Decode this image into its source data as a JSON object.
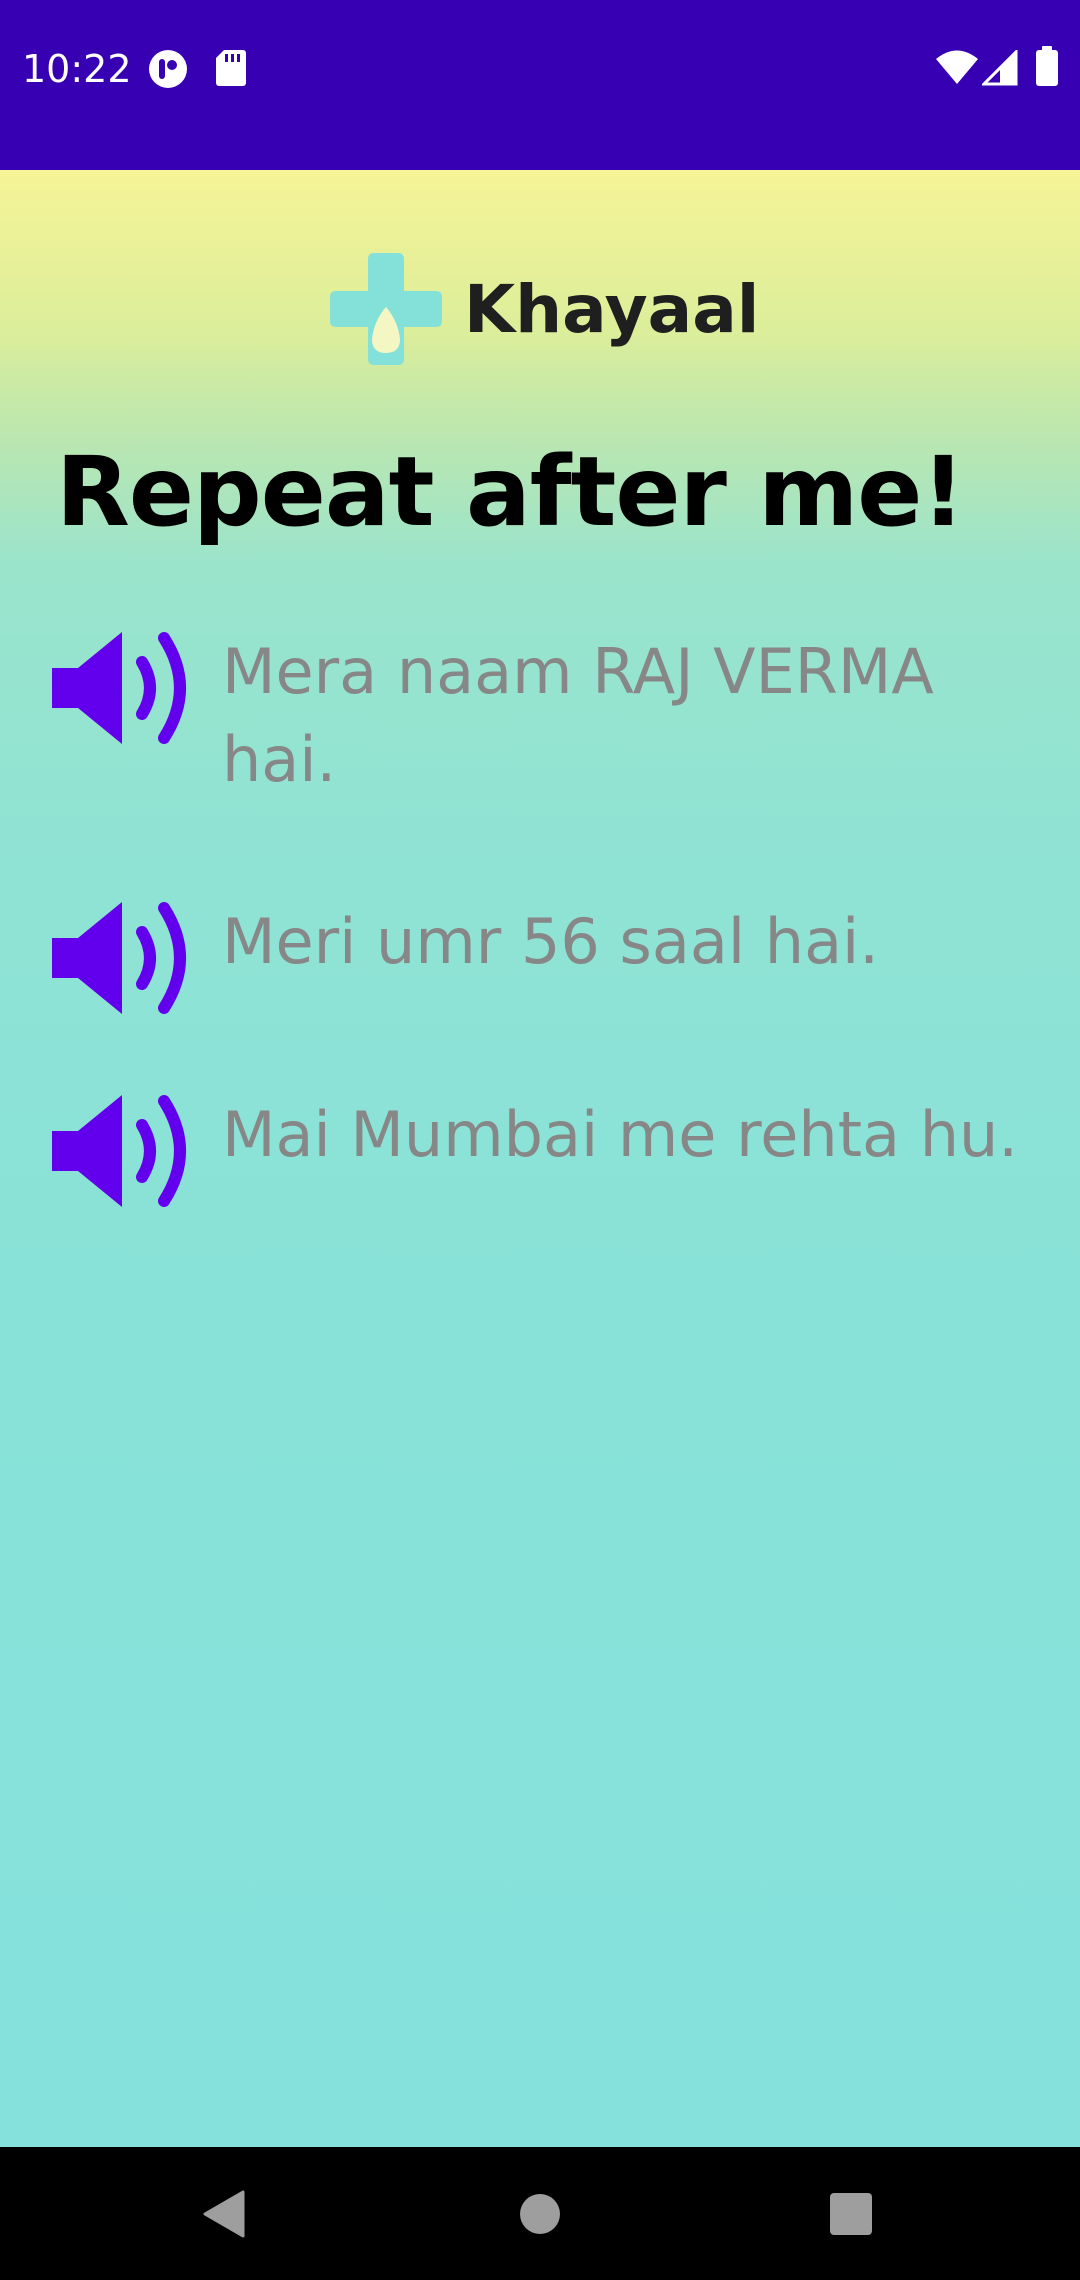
{
  "status_bar": {
    "time": "10:22",
    "icons_left": [
      "media-notification-icon",
      "sd-card-icon"
    ],
    "icons_right": [
      "wifi-icon",
      "signal-icon",
      "battery-icon"
    ]
  },
  "app": {
    "name": "Khayaal",
    "logo_icon": "medical-cross-drop-icon",
    "logo_color": "#84e1d9"
  },
  "page": {
    "title": "Repeat after me!"
  },
  "phrases": [
    {
      "text": "Mera naam RAJ VERMA hai.",
      "icon": "speaker-icon"
    },
    {
      "text": "Meri umr 56 saal hai.",
      "icon": "speaker-icon"
    },
    {
      "text": "Mai Mumbai me rehta hu.",
      "icon": "speaker-icon"
    }
  ],
  "colors": {
    "status_bar": "#3700b3",
    "accent": "#6200ee",
    "phrase_text": "#878787",
    "gradient_top": "#f6f497",
    "gradient_bottom": "#84e1dc"
  },
  "nav_bar": {
    "buttons": [
      "back-icon",
      "home-icon",
      "recents-icon"
    ]
  }
}
